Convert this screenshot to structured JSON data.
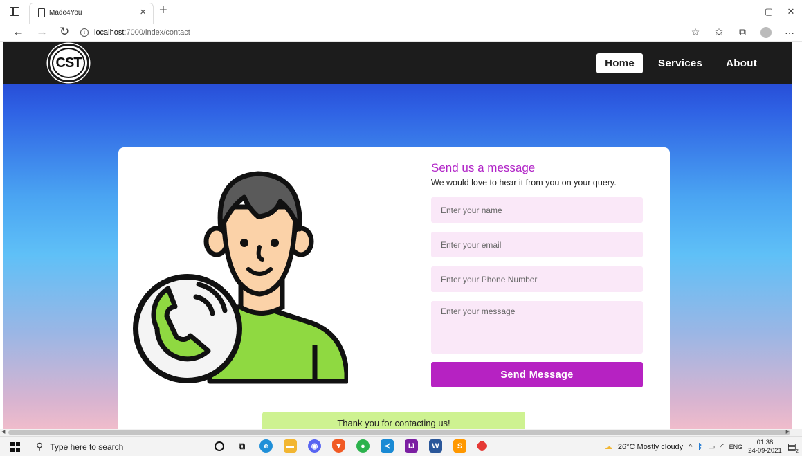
{
  "browser": {
    "tab_title": "Made4You",
    "tab_close": "×",
    "new_tab": "+",
    "win_minimize": "–",
    "win_maximize": "▢",
    "win_close": "✕",
    "back": "←",
    "forward": "→",
    "reload": "↻",
    "url_host": "localhost",
    "url_path": ":7000/index/contact",
    "info": "i",
    "more": "···"
  },
  "site": {
    "logo_text": "CST",
    "nav": [
      {
        "label": "Home",
        "active": true
      },
      {
        "label": "Services",
        "active": false
      },
      {
        "label": "About",
        "active": false
      }
    ]
  },
  "contact_form": {
    "title": "Send us a message",
    "subtitle": "We would love to hear it from you on your query.",
    "name_placeholder": "Enter your name",
    "email_placeholder": "Enter your email",
    "phone_placeholder": "Enter your Phone Number",
    "message_placeholder": "Enter your message",
    "submit_label": "Send Message",
    "success_message": "Thank you for contacting us!"
  },
  "taskbar": {
    "search_placeholder": "Type here to search",
    "weather": "26°C  Mostly cloudy",
    "language": "ENG",
    "time": "01:38",
    "date": "24-09-2021",
    "notifications": "2"
  },
  "colors": {
    "accent": "#b622c2",
    "field_bg": "#fae8f8",
    "success_bg": "#cef291",
    "navbar_bg": "#1c1c1c"
  }
}
